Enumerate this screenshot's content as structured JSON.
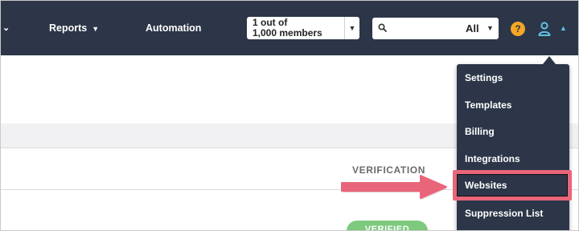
{
  "nav": {
    "reports_label": "Reports",
    "automation_label": "Automation"
  },
  "member_select": {
    "value": "1 out of\n1,000 members"
  },
  "search": {
    "scope": "All",
    "placeholder": ""
  },
  "help": {
    "glyph": "?"
  },
  "table": {
    "verification_header": "VERIFICATION",
    "status_badge": "VERIFIED"
  },
  "user_menu": {
    "items": [
      "Settings",
      "Templates",
      "Billing",
      "Integrations",
      "Websites",
      "Suppression List"
    ],
    "highlighted": "Websites"
  },
  "colors": {
    "nav_background": "#2c3648",
    "highlight": "#e9657a",
    "help_icon": "#f5a623",
    "user_icon": "#5ec4e3",
    "verified_badge": "#7dc97d"
  },
  "icons": [
    "chevron-down-icon",
    "search-icon",
    "help-icon",
    "user-icon",
    "chevron-up-icon",
    "arrow-right-icon"
  ]
}
